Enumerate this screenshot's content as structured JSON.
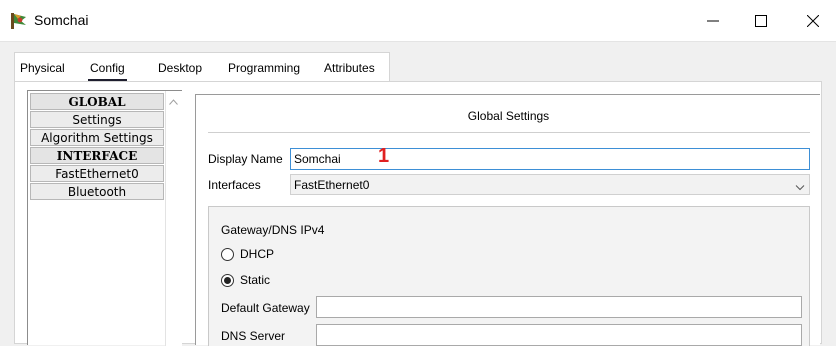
{
  "window": {
    "title": "Somchai",
    "minimize_glyph": "—",
    "maximize_glyph": "☐",
    "close_glyph": "✕"
  },
  "tabs": [
    {
      "label": "Physical",
      "active": false
    },
    {
      "label": "Config",
      "active": true
    },
    {
      "label": "Desktop",
      "active": false
    },
    {
      "label": "Programming",
      "active": false
    },
    {
      "label": "Attributes",
      "active": false
    }
  ],
  "nav": {
    "items": [
      {
        "label": "GLOBAL",
        "header": true
      },
      {
        "label": "Settings",
        "header": false
      },
      {
        "label": "Algorithm Settings",
        "header": false
      },
      {
        "label": "INTERFACE",
        "header": true
      },
      {
        "label": "FastEthernet0",
        "header": false
      },
      {
        "label": "Bluetooth",
        "header": false
      }
    ]
  },
  "global_settings": {
    "title": "Global Settings",
    "display_name_label": "Display Name",
    "display_name_value": "Somchai",
    "annotation": "1",
    "interfaces_label": "Interfaces",
    "interfaces_value": "FastEthernet0",
    "gateway_dns": {
      "title": "Gateway/DNS IPv4",
      "dhcp_label": "DHCP",
      "static_label": "Static",
      "selected": "Static",
      "default_gateway_label": "Default Gateway",
      "default_gateway_value": "",
      "dns_server_label": "DNS Server",
      "dns_server_value": ""
    }
  },
  "icons": {
    "app": "packet-tracer-pc-icon",
    "dropdown": "chevron-down-icon",
    "scroll_up": "scroll-up-arrow-icon"
  },
  "colors": {
    "focus_border": "#3d8fd6",
    "annotation_red": "#e02020",
    "active_tab_underline": "#1e1e2e"
  }
}
